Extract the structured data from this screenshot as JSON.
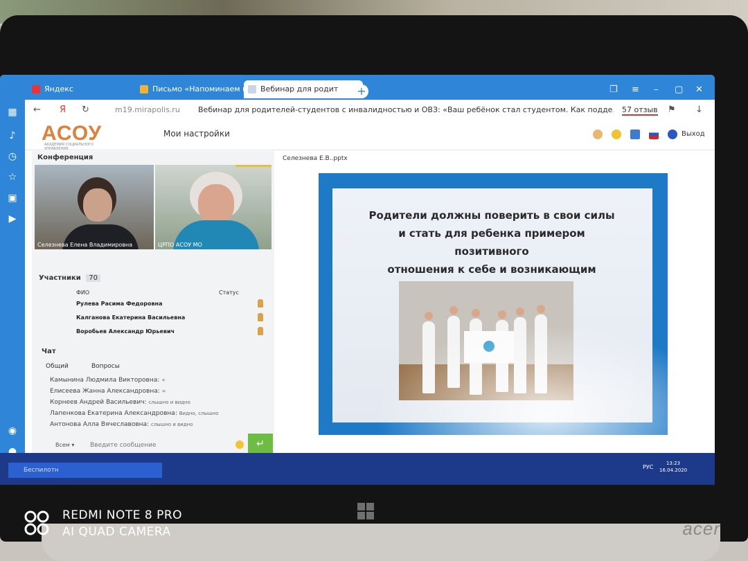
{
  "browser": {
    "tabs": [
      {
        "label": "Яндекс"
      },
      {
        "label": "Письмо «Напоминаем в"
      },
      {
        "label": "Вебинар для родит"
      }
    ],
    "address": {
      "url": "m19.mirapolis.ru",
      "title": "Вебинар для родителей-студентов с инвалидностью и ОВЗ: «Ваш ребёнок стал студентом. Как подде...",
      "reviews": "57 отзыв"
    }
  },
  "header": {
    "logo": "АСОУ",
    "logo_sub": "АКАДЕМИЯ СОЦИАЛЬНОГО УПРАВЛЕНИЯ",
    "my_settings": "Мои настройки",
    "exit": "Выход"
  },
  "conference": {
    "title": "Конференция",
    "videos": [
      {
        "name": "Селезнева Елена Владимировна"
      },
      {
        "name": "ЦРПО АСОУ МО"
      }
    ]
  },
  "participants": {
    "title": "Участники",
    "count": "70",
    "col_name": "ФИО",
    "col_status": "Статус",
    "rows": [
      {
        "name": "Рулева Расима Федоровна"
      },
      {
        "name": "Калганова Екатерина Васильевна"
      },
      {
        "name": "Воробьев Александр Юрьевич"
      }
    ]
  },
  "chat": {
    "title": "Чат",
    "tab_general": "Общий",
    "tab_questions": "Вопросы",
    "messages": [
      {
        "author": "Камынина Людмила Викторовна:",
        "text": "+"
      },
      {
        "author": "Елисеева Жанна Александровна:",
        "text": "="
      },
      {
        "author": "Корнеев Андрей Васильевич:",
        "text": "слышно и видно"
      },
      {
        "author": "Лапенкова Екатерина Александровна:",
        "text": "Видно, слышно"
      },
      {
        "author": "Антонова Алла Вячеславовна:",
        "text": "слышно и видно"
      }
    ],
    "recipient": "Всем",
    "input_placeholder": "Введите сообщение"
  },
  "presentation": {
    "file": "Селезнева Е.В..pptx",
    "slide_text_1": "Родители должны поверить в свои силы",
    "slide_text_2": "и стать для ребенка примером позитивного",
    "slide_text_3": "отношения к себе и возникающим трудностям"
  },
  "taskbar": {
    "search": "Беспилотн",
    "lang": "РУС",
    "time": "13:23",
    "date": "16.04.2020"
  },
  "device": {
    "brand": "acer",
    "watermark_line1": "REDMI NOTE 8 PRO",
    "watermark_line2": "AI QUAD CAMERA"
  },
  "colors": {
    "browser_blue": "#2f86d8",
    "slide_blue": "#1e79c6",
    "logo_orange": "#e0803a",
    "send_green": "#6dbd45"
  }
}
